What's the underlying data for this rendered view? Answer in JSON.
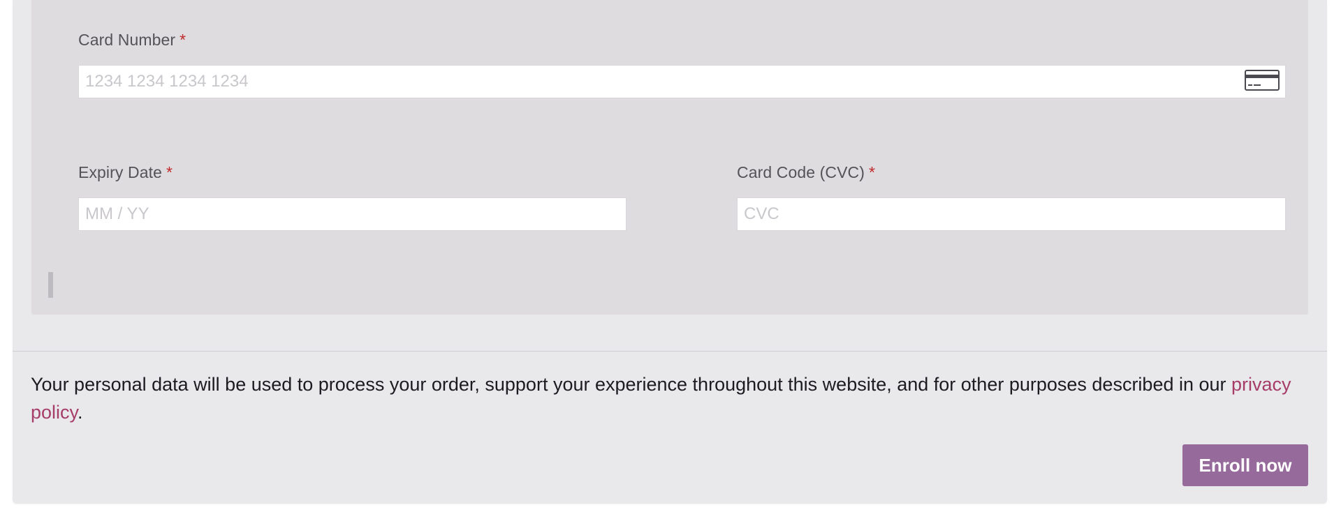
{
  "payment_form": {
    "card_number": {
      "label": "Card Number",
      "required_mark": "*",
      "placeholder": "1234 1234 1234 1234",
      "value": "",
      "icon": "credit-card-icon"
    },
    "expiry_date": {
      "label": "Expiry Date",
      "required_mark": "*",
      "placeholder": "MM / YY",
      "value": ""
    },
    "card_code": {
      "label": "Card Code (CVC)",
      "required_mark": "*",
      "placeholder": "CVC",
      "value": ""
    }
  },
  "privacy": {
    "text": "Your personal data will be used to process your order, support your experience throughout this website, and for other purposes described in our ",
    "link_label": "privacy policy",
    "trailing": "."
  },
  "actions": {
    "enroll_label": "Enroll now"
  },
  "colors": {
    "accent": "#966a9a",
    "link": "#a63d69",
    "required": "#c0292b",
    "outer_background": "#e9e8eb",
    "payment_box_background": "#dedcdf"
  }
}
